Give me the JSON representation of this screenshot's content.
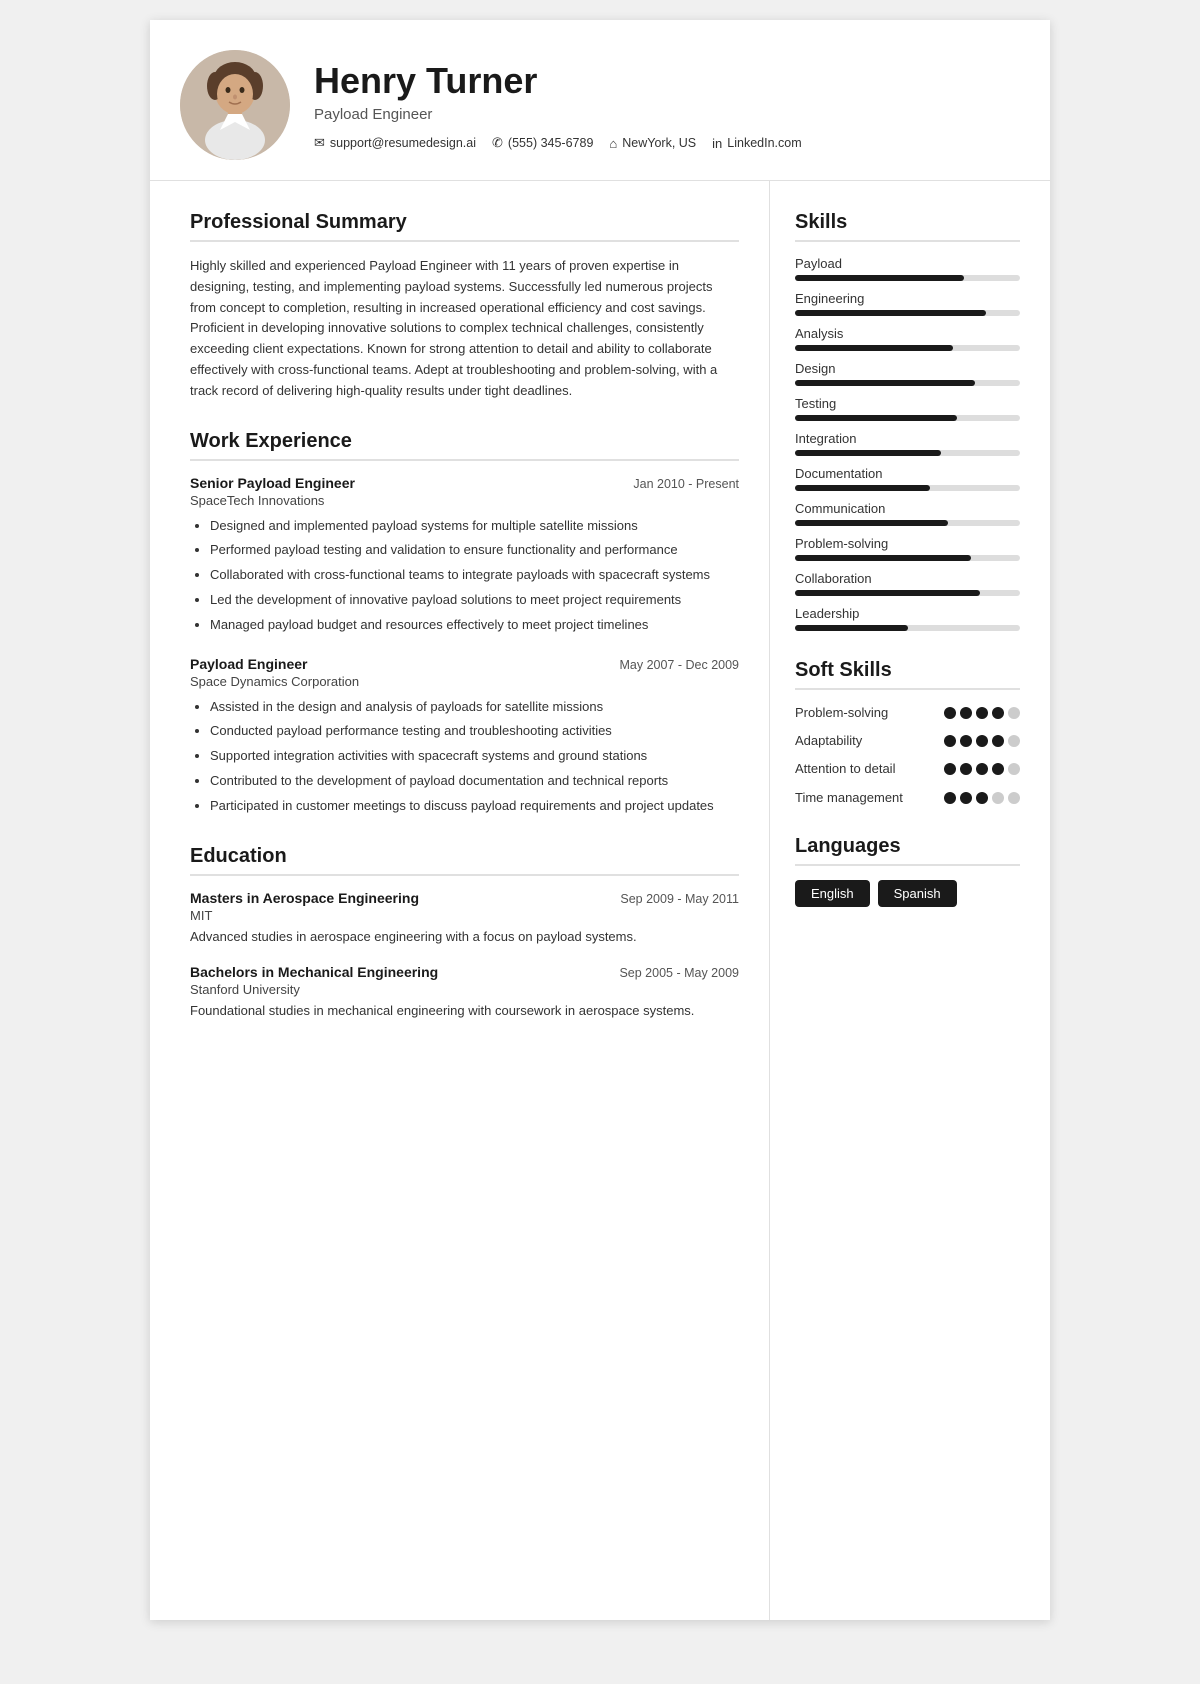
{
  "header": {
    "name": "Henry Turner",
    "title": "Payload Engineer",
    "contacts": [
      {
        "icon": "✉",
        "text": "support@resumedesign.ai",
        "name": "email"
      },
      {
        "icon": "✆",
        "text": "(555) 345-6789",
        "name": "phone"
      },
      {
        "icon": "⌂",
        "text": "NewYork, US",
        "name": "location"
      },
      {
        "icon": "in",
        "text": "LinkedIn.com",
        "name": "linkedin"
      }
    ]
  },
  "professional_summary": {
    "title": "Professional Summary",
    "text": "Highly skilled and experienced Payload Engineer with 11 years of proven expertise in designing, testing, and implementing payload systems. Successfully led numerous projects from concept to completion, resulting in increased operational efficiency and cost savings. Proficient in developing innovative solutions to complex technical challenges, consistently exceeding client expectations. Known for strong attention to detail and ability to collaborate effectively with cross-functional teams. Adept at troubleshooting and problem-solving, with a track record of delivering high-quality results under tight deadlines."
  },
  "work_experience": {
    "title": "Work Experience",
    "jobs": [
      {
        "title": "Senior Payload Engineer",
        "company": "SpaceTech Innovations",
        "dates": "Jan 2010 - Present",
        "bullets": [
          "Designed and implemented payload systems for multiple satellite missions",
          "Performed payload testing and validation to ensure functionality and performance",
          "Collaborated with cross-functional teams to integrate payloads with spacecraft systems",
          "Led the development of innovative payload solutions to meet project requirements",
          "Managed payload budget and resources effectively to meet project timelines"
        ]
      },
      {
        "title": "Payload Engineer",
        "company": "Space Dynamics Corporation",
        "dates": "May 2007 - Dec 2009",
        "bullets": [
          "Assisted in the design and analysis of payloads for satellite missions",
          "Conducted payload performance testing and troubleshooting activities",
          "Supported integration activities with spacecraft systems and ground stations",
          "Contributed to the development of payload documentation and technical reports",
          "Participated in customer meetings to discuss payload requirements and project updates"
        ]
      }
    ]
  },
  "education": {
    "title": "Education",
    "entries": [
      {
        "degree": "Masters in Aerospace Engineering",
        "school": "MIT",
        "dates": "Sep 2009 - May 2011",
        "desc": "Advanced studies in aerospace engineering with a focus on payload systems."
      },
      {
        "degree": "Bachelors in Mechanical Engineering",
        "school": "Stanford University",
        "dates": "Sep 2005 - May 2009",
        "desc": "Foundational studies in mechanical engineering with coursework in aerospace systems."
      }
    ]
  },
  "skills": {
    "title": "Skills",
    "items": [
      {
        "name": "Payload",
        "level": 75
      },
      {
        "name": "Engineering",
        "level": 85
      },
      {
        "name": "Analysis",
        "level": 70
      },
      {
        "name": "Design",
        "level": 80
      },
      {
        "name": "Testing",
        "level": 72
      },
      {
        "name": "Integration",
        "level": 65
      },
      {
        "name": "Documentation",
        "level": 60
      },
      {
        "name": "Communication",
        "level": 68
      },
      {
        "name": "Problem-solving",
        "level": 78
      },
      {
        "name": "Collaboration",
        "level": 82
      },
      {
        "name": "Leadership",
        "level": 50
      }
    ]
  },
  "soft_skills": {
    "title": "Soft Skills",
    "items": [
      {
        "name": "Problem-solving",
        "filled": 4,
        "total": 5
      },
      {
        "name": "Adaptability",
        "filled": 4,
        "total": 5
      },
      {
        "name": "Attention to detail",
        "filled": 4,
        "total": 5
      },
      {
        "name": "Time management",
        "filled": 3,
        "total": 5
      }
    ]
  },
  "languages": {
    "title": "Languages",
    "items": [
      "English",
      "Spanish"
    ]
  }
}
